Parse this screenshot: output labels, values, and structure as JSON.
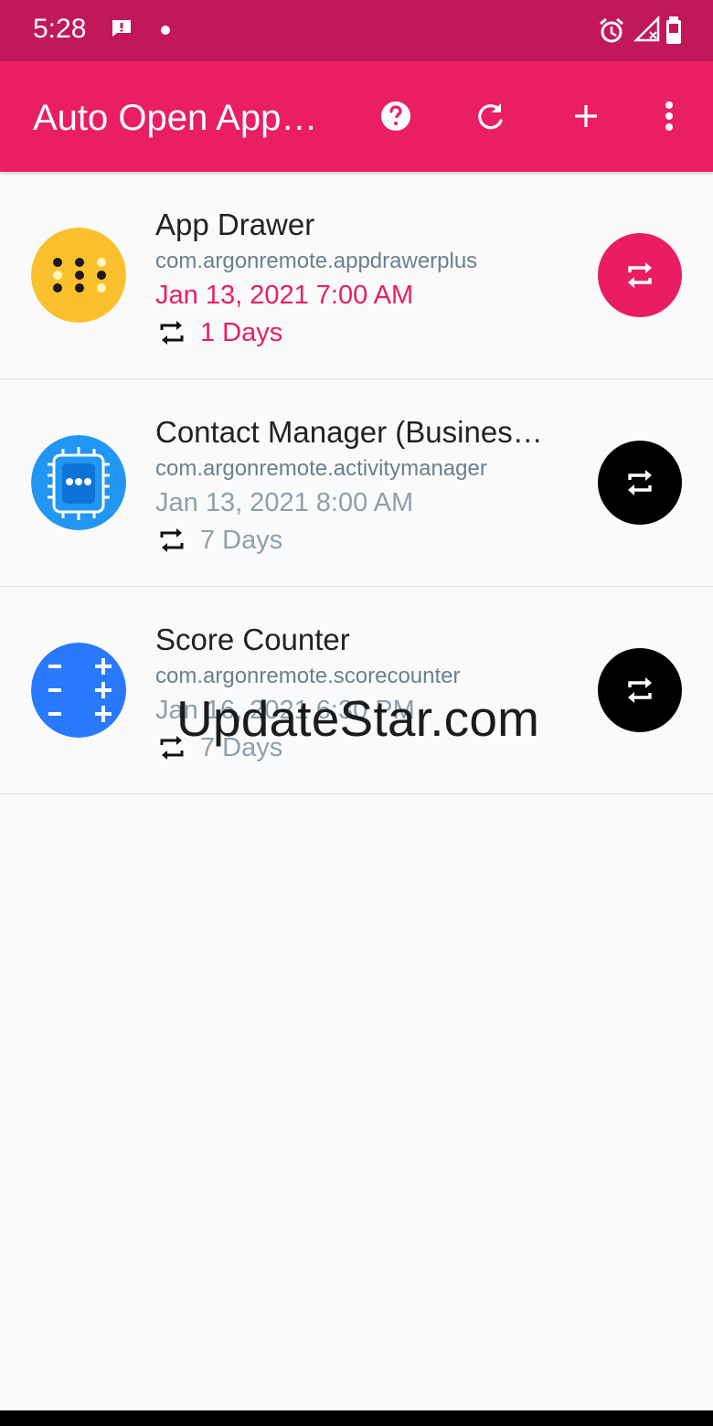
{
  "status_bar": {
    "time": "5:28",
    "icons": [
      "message-icon",
      "dot-icon",
      "alarm-icon",
      "signal-icon",
      "battery-icon"
    ]
  },
  "app_bar": {
    "title": "Auto Open App…",
    "actions": [
      "help-icon",
      "refresh-icon",
      "add-icon",
      "more-vert-icon"
    ]
  },
  "apps": [
    {
      "name": "App Drawer",
      "package": "com.argonremote.appdrawerplus",
      "schedule": "Jan 13, 2021 7:00 AM",
      "interval": "1 Days",
      "active": true,
      "icon": "app-drawer-icon",
      "icon_color": "#fbc02d"
    },
    {
      "name": "Contact Manager (Busines…",
      "package": "com.argonremote.activitymanager",
      "schedule": "Jan 13, 2021 8:00 AM",
      "interval": "7 Days",
      "active": false,
      "icon": "contact-manager-icon",
      "icon_color": "#2196f3"
    },
    {
      "name": "Score Counter",
      "package": "com.argonremote.scorecounter",
      "schedule": "Jan 16, 2021 6:30 PM",
      "interval": "7 Days",
      "active": false,
      "icon": "score-counter-icon",
      "icon_color": "#2979ff"
    }
  ],
  "watermark": "UpdateStar.com",
  "colors": {
    "primary": "#e91e63",
    "primary_dark": "#c2185b",
    "secondary_text": "#8fa0aa"
  }
}
